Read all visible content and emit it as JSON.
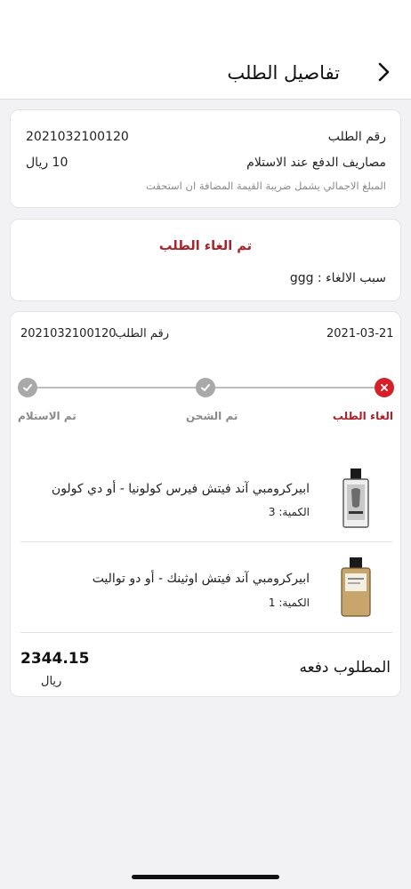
{
  "header": {
    "title": "تفاصيل الطلب"
  },
  "summary": {
    "order_no_label": "رقم الطلب",
    "order_no": "2021032100120",
    "cod_label": "مصاريف الدفع عند الاستلام",
    "cod_value": "10 ريال",
    "vat_note": "المبلغ الاجمالي يشمل ضريبة القيمة المضافة ان استحقت"
  },
  "cancel": {
    "status": "تم الغاء الطلب",
    "reason": "سبب الالغاء : ggg"
  },
  "order": {
    "date": "2021-03-21",
    "order_no_label": "رقم الطلب",
    "order_no": "2021032100120",
    "steps": [
      {
        "label": "الغاء الطلب",
        "state": "cancelled"
      },
      {
        "label": "تم الشحن",
        "state": "done"
      },
      {
        "label": "تم الاستلام",
        "state": "done"
      }
    ],
    "items": [
      {
        "name": "ابيركرومبي آند فيتش فيرس كولونيا - أو دي كولون",
        "qty": "الكمية: 3"
      },
      {
        "name": "ابيركرومبي آند فيتش اوثينك - أو دو تواليت",
        "qty": "الكمية: 1"
      }
    ],
    "total_label": "المطلوب دفعه",
    "total_value": "2344.15",
    "currency": "ريال"
  },
  "colors": {
    "accent": "#a8232b",
    "cancel_red": "#d42028",
    "done_gray": "#a9a9a9"
  }
}
